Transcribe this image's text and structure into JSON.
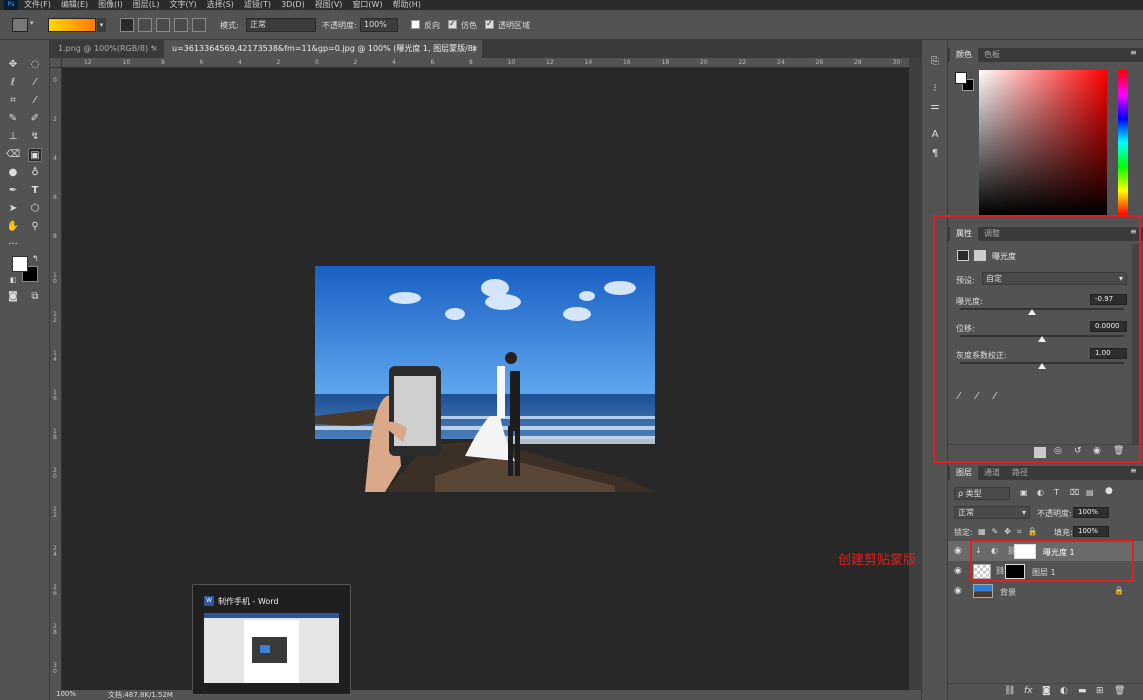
{
  "menu": [
    "文件(F)",
    "编辑(E)",
    "图像(I)",
    "图层(L)",
    "文字(Y)",
    "选择(S)",
    "滤镜(T)",
    "3D(D)",
    "视图(V)",
    "窗口(W)",
    "帮助(H)"
  ],
  "app_logo": "Ps",
  "options": {
    "mode_label": "模式:",
    "mode_value": "正常",
    "opacity_label": "不透明度:",
    "opacity_value": "100%",
    "reverse_label": "反向",
    "dither_label": "仿色",
    "transparency_label": "透明区域"
  },
  "doc_tabs": [
    {
      "label": "1.png @ 100%(RGB/8) *",
      "active": false
    },
    {
      "label": "u=3613364569,42173538&fm=11&gp=0.jpg @ 100% (曝光度 1, 图层蒙版/8) *",
      "active": true
    }
  ],
  "rulers": {
    "top": [
      "12",
      "10",
      "8",
      "6",
      "4",
      "2",
      "0",
      "2",
      "4",
      "6",
      "8",
      "10",
      "12",
      "14",
      "16",
      "18",
      "20",
      "22",
      "24",
      "26",
      "28",
      "30"
    ],
    "left": [
      "0",
      "2",
      "4",
      "6",
      "8",
      "1\n0",
      "1\n2",
      "1\n4",
      "1\n6",
      "1\n8",
      "2\n0",
      "2\n2",
      "2\n4",
      "2\n6",
      "2\n8",
      "3\n0"
    ]
  },
  "status": {
    "zoom": "100%",
    "doc_info": "文档:487.8K/1.52M"
  },
  "color_panel": {
    "tabs": [
      "颜色",
      "色板"
    ]
  },
  "properties_panel": {
    "tabs": [
      "属性",
      "调整"
    ],
    "title": "曝光度",
    "preset_label": "预设:",
    "preset_value": "自定",
    "exposure_label": "曝光度:",
    "exposure_value": "-0.97",
    "exposure_level": 0.44,
    "offset_label": "位移:",
    "offset_value": "0.0000",
    "offset_level": 0.5,
    "gamma_label": "灰度系数校正:",
    "gamma_value": "1.00",
    "gamma_level": 0.5
  },
  "layers_panel": {
    "tabs": [
      "图层",
      "通道",
      "路径"
    ],
    "filter_label": "ρ 类型",
    "blend_value": "正常",
    "opacity_label": "不透明度:",
    "opacity_value": "100%",
    "lock_label": "锁定:",
    "fill_label": "填充:",
    "fill_value": "100%",
    "layers": [
      {
        "name": "曝光度 1",
        "type": "adjustment",
        "clipped": true
      },
      {
        "name": "图层 1",
        "type": "image"
      },
      {
        "name": "背景",
        "type": "background",
        "locked": true
      }
    ]
  },
  "annotation": "创建剪贴蒙版",
  "taskbar_preview": {
    "title": "制作手机 - Word"
  },
  "colors": {
    "annotation_red": "#e02020",
    "sky": "#2f7fd6",
    "panel_bg": "#535353"
  }
}
